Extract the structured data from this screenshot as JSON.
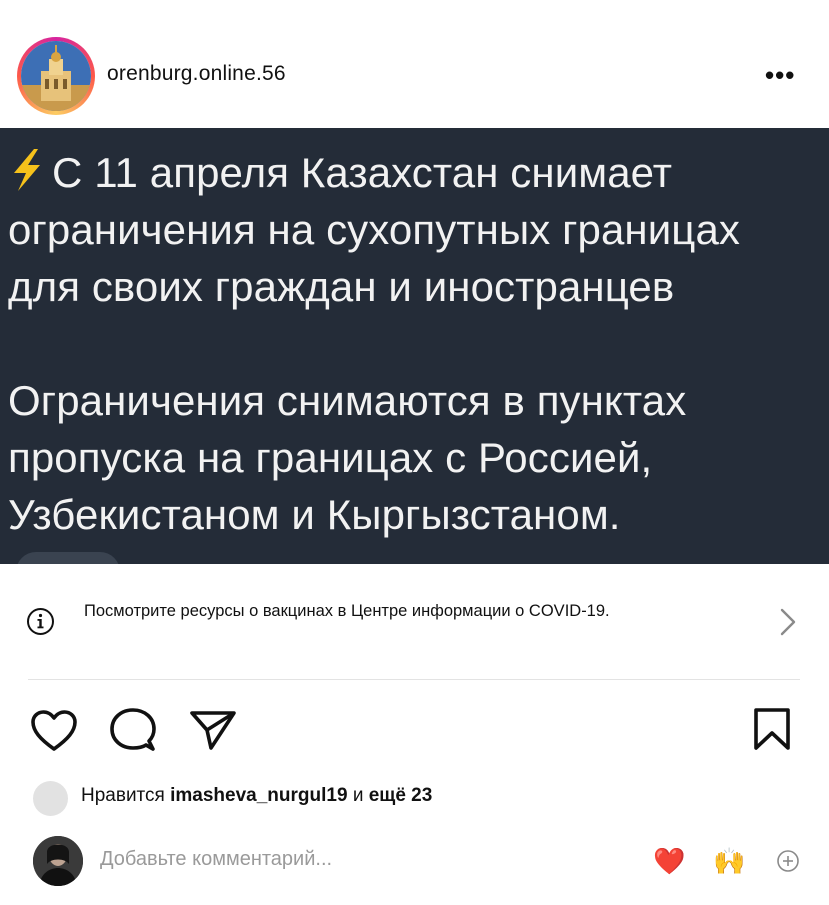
{
  "header": {
    "username": "orenburg.online.56",
    "more_label": "•••"
  },
  "post": {
    "lines": [
      "С 11 апреля Казахстан снимает",
      "ограничения на сухопутных границах",
      "для своих граждан и иностранцев",
      "Ограничения снимаются в пунктах",
      "пропуска на границах с Россией,",
      "Узбекистаном и Кыргызстаном."
    ],
    "background": "#242c38",
    "text_color": "#f2f2f2"
  },
  "covid_banner": {
    "text": "Посмотрите ресурсы о вакцинах в Центре информации о COVID-19."
  },
  "actions": {
    "icons": [
      "heart-icon",
      "comment-icon",
      "share-icon",
      "bookmark-icon"
    ]
  },
  "likes": {
    "prefix": "Нравится ",
    "user": "imasheva_nurgul19",
    "middle": " и ",
    "rest": "ещё 23"
  },
  "comment": {
    "placeholder": "Добавьте комментарий...",
    "emoji_heart": "❤️",
    "emoji_hands": "🙌"
  }
}
